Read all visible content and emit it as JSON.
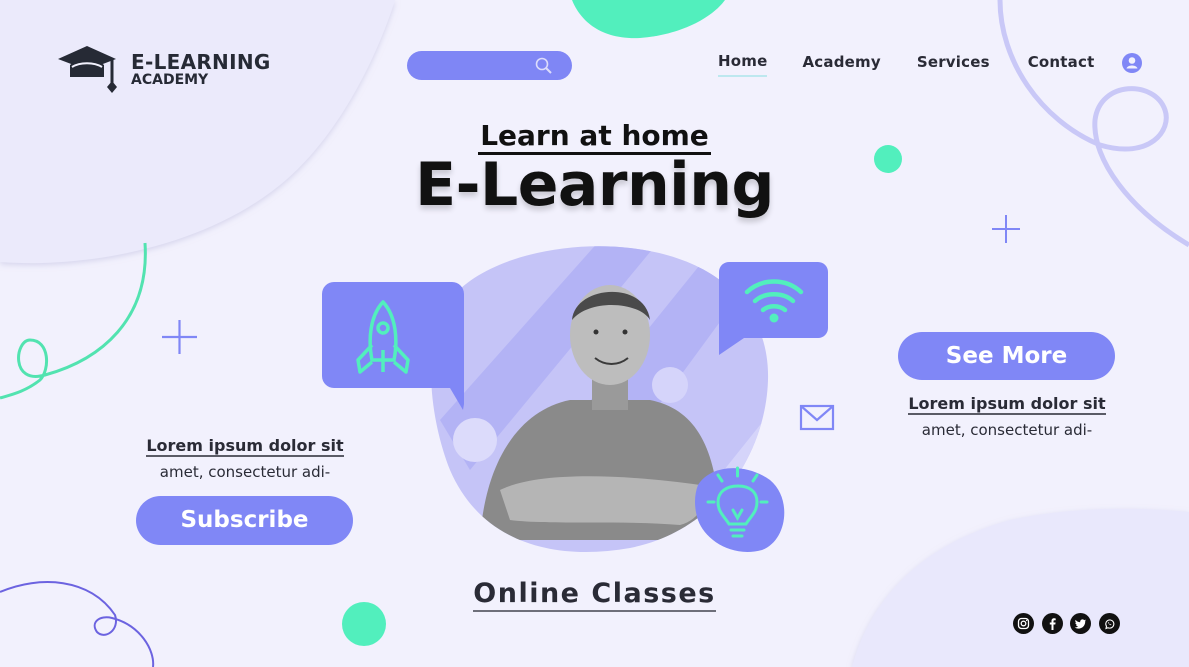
{
  "brand": {
    "title": "E-LEARNING",
    "subtitle": "ACADEMY",
    "logo_icon": "graduation-cap-icon"
  },
  "search": {
    "placeholder": "",
    "value": "",
    "icon": "search-icon"
  },
  "nav": {
    "items": [
      {
        "label": "Home",
        "active": true
      },
      {
        "label": "Academy",
        "active": false
      },
      {
        "label": "Services",
        "active": false
      },
      {
        "label": "Contact",
        "active": false
      }
    ],
    "user_icon": "user-icon"
  },
  "hero": {
    "subheading": "Learn at home",
    "heading": "E-Learning",
    "icons": [
      "rocket-icon",
      "wifi-icon",
      "lightbulb-icon",
      "mail-icon"
    ]
  },
  "left_block": {
    "title": "Lorem ipsum dolor sit",
    "body": "amet, consectetur adi-",
    "button_label": "Subscribe"
  },
  "right_block": {
    "button_label": "See More",
    "title": "Lorem ipsum dolor sit",
    "body": "amet, consectetur adi-"
  },
  "footer": {
    "caption": "Online Classes",
    "social": [
      "instagram-icon",
      "facebook-icon",
      "twitter-icon",
      "whatsapp-icon"
    ]
  },
  "colors": {
    "background": "#f2f1fd",
    "accent_purple": "#8087f6",
    "accent_green": "#52efbd",
    "text_dark": "#24252f"
  }
}
